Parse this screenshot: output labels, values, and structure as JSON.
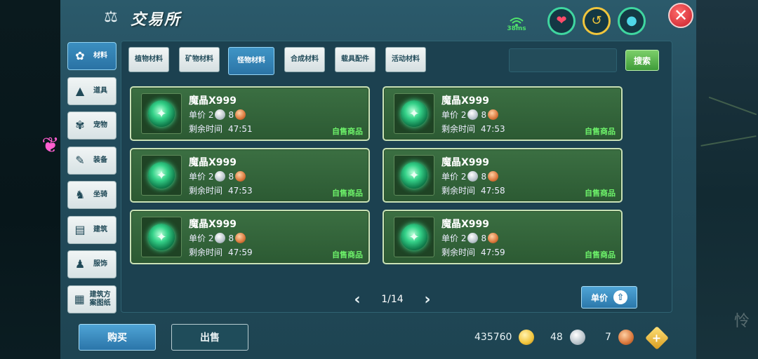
{
  "header": {
    "title": "交易所",
    "ping": "38ms"
  },
  "side_menu": {
    "items": [
      {
        "label": "材料",
        "icon": "material-icon",
        "active": true
      },
      {
        "label": "道具",
        "icon": "potion-icon",
        "active": false
      },
      {
        "label": "宠物",
        "icon": "paw-icon",
        "active": false
      },
      {
        "label": "装备",
        "icon": "equipment-icon",
        "active": false
      },
      {
        "label": "坐骑",
        "icon": "mount-icon",
        "active": false
      },
      {
        "label": "建筑",
        "icon": "building-icon",
        "active": false
      },
      {
        "label": "服饰",
        "icon": "clothing-icon",
        "active": false
      },
      {
        "label": "建筑方案图纸",
        "icon": "blueprint-icon",
        "active": false
      }
    ]
  },
  "category_tabs": [
    {
      "label": "植物材料",
      "active": false
    },
    {
      "label": "矿物材料",
      "active": false
    },
    {
      "label": "怪物材料",
      "active": true
    },
    {
      "label": "合成材料",
      "active": false
    },
    {
      "label": "载具配件",
      "active": false
    },
    {
      "label": "活动材料",
      "active": false
    }
  ],
  "search": {
    "placeholder": "",
    "button_label": "搜索"
  },
  "listings": [
    {
      "name": "魔晶X999",
      "price_label": "单价",
      "silver": "2",
      "copper": "8",
      "time_label": "剩余时间",
      "time": "47:51",
      "tag": "自售商品"
    },
    {
      "name": "魔晶X999",
      "price_label": "单价",
      "silver": "2",
      "copper": "8",
      "time_label": "剩余时间",
      "time": "47:53",
      "tag": "自售商品"
    },
    {
      "name": "魔晶X999",
      "price_label": "单价",
      "silver": "2",
      "copper": "8",
      "time_label": "剩余时间",
      "time": "47:53",
      "tag": "自售商品"
    },
    {
      "name": "魔晶X999",
      "price_label": "单价",
      "silver": "2",
      "copper": "8",
      "time_label": "剩余时间",
      "time": "47:58",
      "tag": "自售商品"
    },
    {
      "name": "魔晶X999",
      "price_label": "单价",
      "silver": "2",
      "copper": "8",
      "time_label": "剩余时间",
      "time": "47:59",
      "tag": "自售商品"
    },
    {
      "name": "魔晶X999",
      "price_label": "单价",
      "silver": "2",
      "copper": "8",
      "time_label": "剩余时间",
      "time": "47:59",
      "tag": "自售商品"
    }
  ],
  "pagination": {
    "current": "1/14",
    "prev_icon": "chevron-left-icon",
    "next_icon": "chevron-right-icon"
  },
  "sort_button": {
    "label": "单价"
  },
  "bottom": {
    "buy_label": "购买",
    "sell_label": "出售",
    "gold": "435760",
    "silver": "48",
    "copper": "7"
  },
  "colors": {
    "panel": "#2b5a6b",
    "card": "#2c5a33",
    "tag_green": "#6df26a",
    "active_blue": "#2b74a6"
  }
}
